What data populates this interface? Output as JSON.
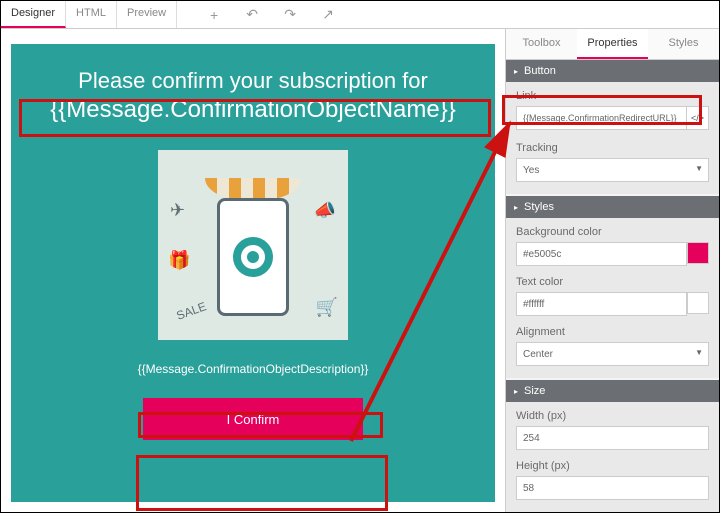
{
  "toolbar": {
    "tabs": {
      "designer": "Designer",
      "html": "HTML",
      "preview": "Preview"
    }
  },
  "canvas": {
    "heading": "Please confirm your subscription for",
    "object_name": "{{Message.ConfirmationObjectName}}",
    "object_desc": "{{Message.ConfirmationObjectDescription}}",
    "confirm_label": "I Confirm"
  },
  "panel": {
    "tabs": {
      "toolbox": "Toolbox",
      "properties": "Properties",
      "styles": "Styles"
    },
    "button_section": "Button",
    "link_label": "Link",
    "link_value": "{{Message.ConfirmationRedirectURL}}",
    "tracking_label": "Tracking",
    "tracking_value": "Yes",
    "styles_section": "Styles",
    "bgcolor_label": "Background color",
    "bgcolor_value": "#e5005c",
    "textcolor_label": "Text color",
    "textcolor_value": "#ffffff",
    "alignment_label": "Alignment",
    "alignment_value": "Center",
    "size_section": "Size",
    "width_label": "Width (px)",
    "width_value": "254",
    "height_label": "Height (px)",
    "height_value": "58"
  }
}
